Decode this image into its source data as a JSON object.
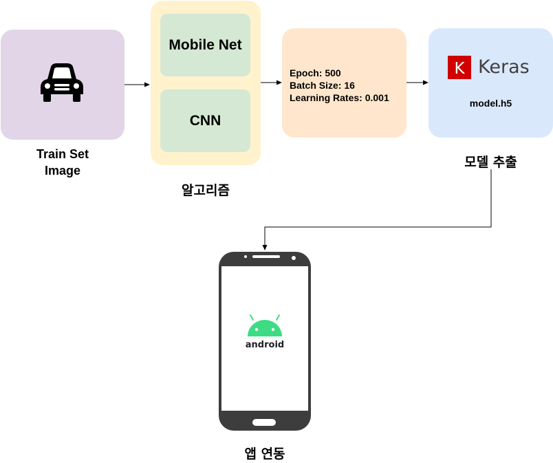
{
  "nodes": {
    "train": {
      "label_line1": "Train Set",
      "label_line2": "Image",
      "icon": "car-icon"
    },
    "algorithm": {
      "label": "알고리즘",
      "items": [
        "Mobile Net",
        "CNN"
      ]
    },
    "params": {
      "lines": [
        "Epoch: 500",
        "Batch Size: 16",
        "Learning Rates: 0.001"
      ]
    },
    "model": {
      "logo_letter": "K",
      "logo_text": "Keras",
      "file": "model.h5",
      "label": "모델 추출"
    },
    "app": {
      "label": "앱 연동",
      "brand": "android",
      "icon": "android-phone-icon"
    }
  },
  "edges": [
    {
      "from": "train",
      "to": "algorithm"
    },
    {
      "from": "algorithm",
      "to": "params"
    },
    {
      "from": "params",
      "to": "model"
    },
    {
      "from": "model",
      "to": "app"
    }
  ],
  "colors": {
    "train": "#e1d5e7",
    "algorithm": "#fff2cc",
    "algorithm_item": "#d5e8d4",
    "params": "#ffe6cc",
    "model": "#dae8fc",
    "keras_red": "#d00000",
    "android_green": "#3ddc84"
  }
}
